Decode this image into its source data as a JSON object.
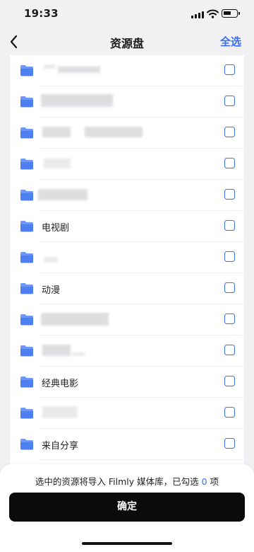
{
  "status_bar": {
    "time": "19:33"
  },
  "nav": {
    "title": "资源盘",
    "select_all": "全选"
  },
  "colors": {
    "accent": "#3a6df0",
    "folder": "#6d98f7",
    "button": "#0b0b0b"
  },
  "icons": {
    "back": "chevron-left-icon",
    "folder": "folder-icon",
    "checkbox": "checkbox-empty-icon"
  },
  "list": {
    "items": [
      {
        "label": "",
        "redacted": true,
        "checked": false
      },
      {
        "label": "",
        "redacted": true,
        "checked": false
      },
      {
        "label": "",
        "redacted": true,
        "checked": false
      },
      {
        "label": "",
        "redacted": true,
        "checked": false
      },
      {
        "label": "",
        "redacted": true,
        "checked": false
      },
      {
        "label": "电视剧",
        "redacted": false,
        "checked": false
      },
      {
        "label": "",
        "redacted": true,
        "checked": false
      },
      {
        "label": "动漫",
        "redacted": false,
        "checked": false
      },
      {
        "label": "",
        "redacted": true,
        "checked": false
      },
      {
        "label": "",
        "redacted": true,
        "checked": false
      },
      {
        "label": "经典电影",
        "redacted": false,
        "checked": false
      },
      {
        "label": "",
        "redacted": true,
        "checked": false
      },
      {
        "label": "来自分享",
        "redacted": false,
        "checked": false
      }
    ]
  },
  "footer": {
    "import_prefix": "选中的资源将导入 Filmly 媒体库，已勾选 ",
    "selected_count": "0",
    "import_suffix": " 项",
    "confirm_label": "确定"
  }
}
